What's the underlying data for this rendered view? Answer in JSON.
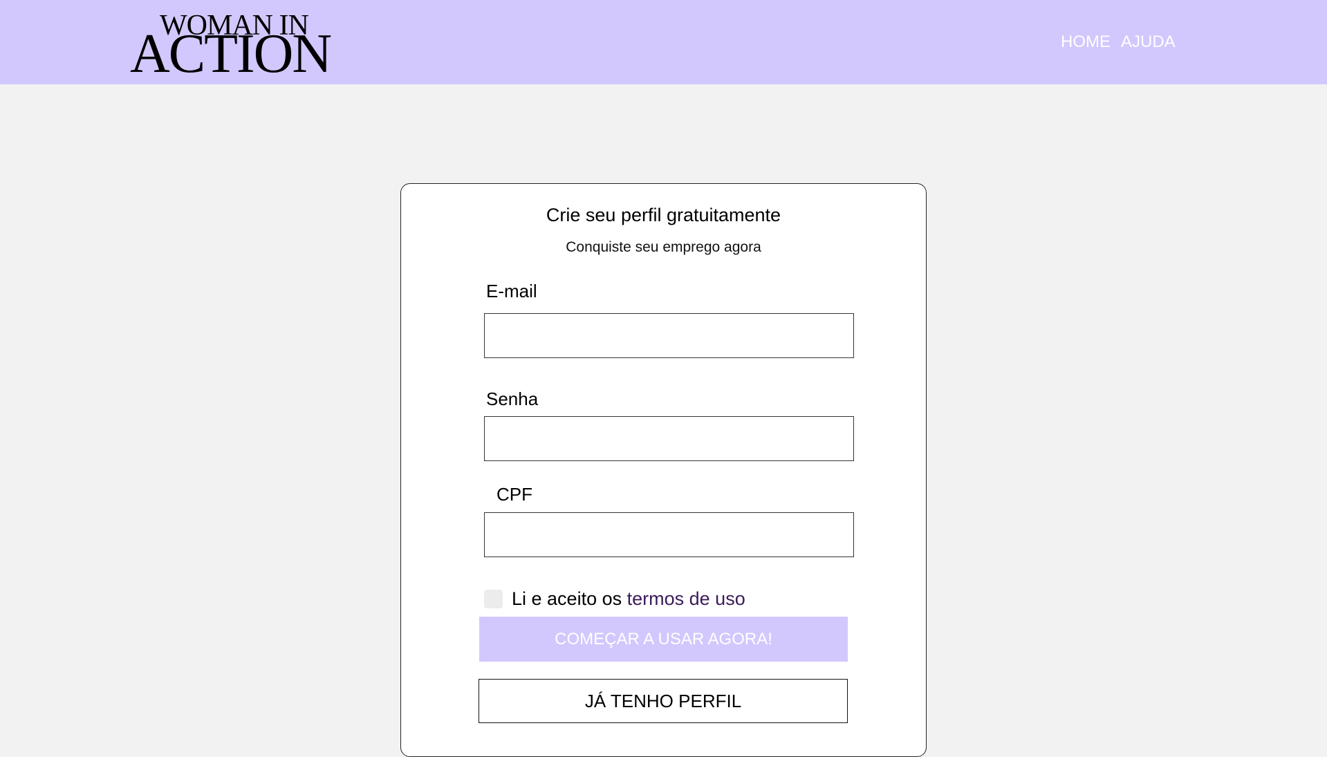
{
  "header": {
    "logo_top": "WOMAN IN",
    "logo_bottom": "ACTION",
    "nav": [
      {
        "label": "HOME"
      },
      {
        "label": "AJUDA"
      }
    ],
    "background_color": "#d2c8fe"
  },
  "form": {
    "title": "Crie seu perfil gratuitamente",
    "subtitle": "Conquiste seu emprego agora",
    "fields": {
      "email": {
        "label": "E-mail",
        "value": "",
        "placeholder": ""
      },
      "password": {
        "label": "Senha",
        "value": "",
        "placeholder": ""
      },
      "cpf": {
        "label": "CPF",
        "value": "",
        "placeholder": ""
      }
    },
    "terms": {
      "prefix": "Li e aceito os",
      "link": "termos de uso",
      "checked": false
    },
    "primary_button": "COMEÇAR A USAR AGORA!",
    "secondary_button": "JÁ TENHO PERFIL"
  },
  "colors": {
    "accent": "#d2c8fe",
    "page_background": "#f2f2f2",
    "link": "#3a1a5a"
  }
}
